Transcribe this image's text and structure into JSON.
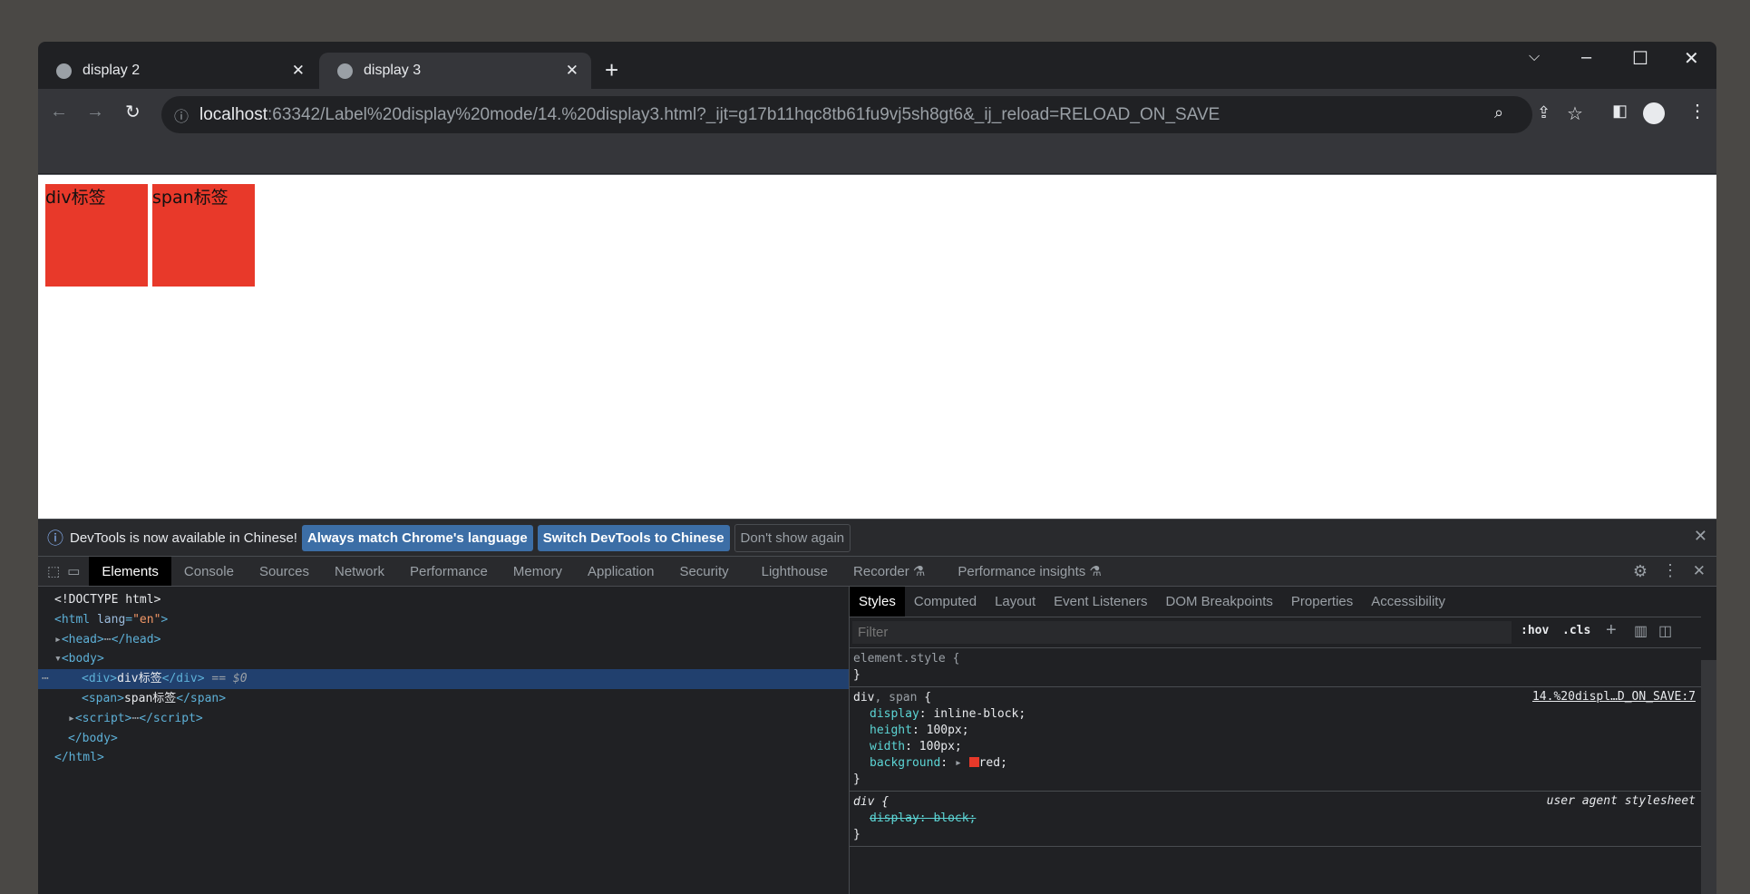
{
  "tabs": [
    {
      "label": "display 2",
      "active": false
    },
    {
      "label": "display 3",
      "active": true
    }
  ],
  "address": {
    "host": "localhost",
    "path": ":63342/Label%20display%20mode/14.%20display3.html?_ijt=g17b11hqc8tb61fu9vj5sh8gt6&_ij_reload=RELOAD_ON_SAVE"
  },
  "page": {
    "div_text": "div标签",
    "span_text": "span标签",
    "box_color": "#e8392a"
  },
  "infobar": {
    "message": "DevTools is now available in Chinese!",
    "btn_match": "Always match Chrome's language",
    "btn_switch": "Switch DevTools to Chinese",
    "btn_dont": "Don't show again"
  },
  "devtools_tabs": [
    "Elements",
    "Console",
    "Sources",
    "Network",
    "Performance",
    "Memory",
    "Application",
    "Security",
    "Lighthouse",
    "Recorder ⚗",
    "Performance insights ⚗"
  ],
  "dom": {
    "doctype": "<!DOCTYPE html>",
    "html_open": "<html",
    "lang_attr": "lang",
    "lang_val": "\"en\"",
    "head": "<head>",
    "head_close": "</head>",
    "body": "<body>",
    "div_open": "<div>",
    "div_text": "div标签",
    "div_close": "</div>",
    "div_eq": " == $0",
    "span_open": "<span>",
    "span_text": "span标签",
    "span_close": "</span>",
    "script": "<script>",
    "script_close": "</script>",
    "body_close": "</body>",
    "html_close": "</html>"
  },
  "styles_tabs": [
    "Styles",
    "Computed",
    "Layout",
    "Event Listeners",
    "DOM Breakpoints",
    "Properties",
    "Accessibility"
  ],
  "styles": {
    "filter_placeholder": "Filter",
    "hov": ":hov",
    "cls": ".cls",
    "element_style": "element.style {",
    "close": "}",
    "sel_div": "div",
    "sel_span": ", span",
    "open": " {",
    "source": "14.%20displ…D_ON_SAVE:7",
    "props": [
      {
        "n": "display",
        "v": "inline-block;"
      },
      {
        "n": "height",
        "v": "100px;"
      },
      {
        "n": "width",
        "v": "100px;"
      },
      {
        "n": "background",
        "v": "red;"
      }
    ],
    "ua_sel": "div {",
    "ua_label": "user agent stylesheet",
    "ua_prop": "display: block;"
  }
}
